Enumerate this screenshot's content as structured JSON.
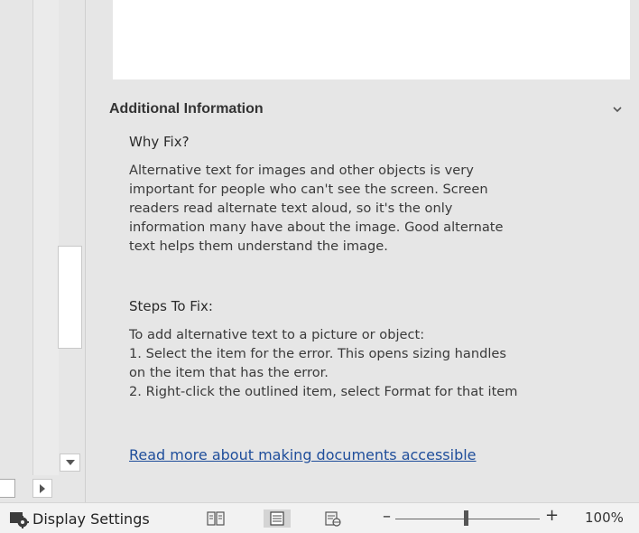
{
  "section": {
    "title": "Additional Information"
  },
  "why_fix": {
    "heading": "Why Fix?",
    "lines": [
      "Alternative text for images and other objects is very",
      "important for people who can't see the screen. Screen",
      "readers read alternate text aloud, so it's the only",
      "information many have about the image. Good alternate",
      "text helps them understand the image."
    ]
  },
  "steps": {
    "heading": "Steps To Fix:",
    "lines": [
      "To add alternative text to a picture or object:",
      "1. Select the item for the error. This opens sizing handles",
      "on the item that has the error.",
      "2. Right-click the outlined item, select Format for that item"
    ]
  },
  "read_more_link": "Read more about making documents accessible",
  "status_bar": {
    "display_settings_label": "Display Settings",
    "zoom_level": "100%",
    "zoom_out_label": "–",
    "zoom_in_label": "+"
  },
  "icons": {
    "display_settings": "display-settings-icon",
    "read_mode": "read-mode-icon",
    "print_layout": "print-layout-icon",
    "web_layout": "web-layout-icon",
    "collapse": "chevron-down-icon"
  },
  "colors": {
    "link": "#1f4e9b",
    "pane_background": "#e6e6e6"
  }
}
